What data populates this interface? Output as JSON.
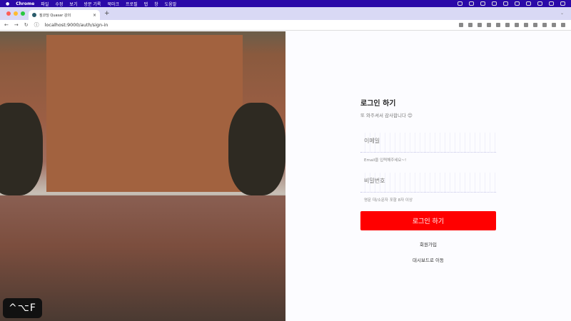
{
  "menubar": {
    "app": "Chrome",
    "items": [
      "파일",
      "수정",
      "보기",
      "방문 기록",
      "북마크",
      "프로필",
      "탭",
      "창",
      "도움말"
    ]
  },
  "browser": {
    "tab_title": "짐코딩 Quasar 강의",
    "tab_close": "×",
    "new_tab": "+",
    "url": "localhost:9000/auth/sign-in",
    "back": "←",
    "forward": "→",
    "reload": "↻",
    "info": "ⓘ"
  },
  "login": {
    "title": "로그인 하기",
    "subtitle": "또 와주셔서 감사합니다 😊",
    "email_label": "이메일",
    "email_hint": "Email을 입력해주세요~!",
    "password_label": "비밀번호",
    "password_hint": "영문 대/소문자 포함 8자 이상",
    "submit": "로그인 하기",
    "signup": "회원가입",
    "dashboard": "대시보드로 이동"
  },
  "overlay": {
    "shortcut": "^⌥F"
  }
}
